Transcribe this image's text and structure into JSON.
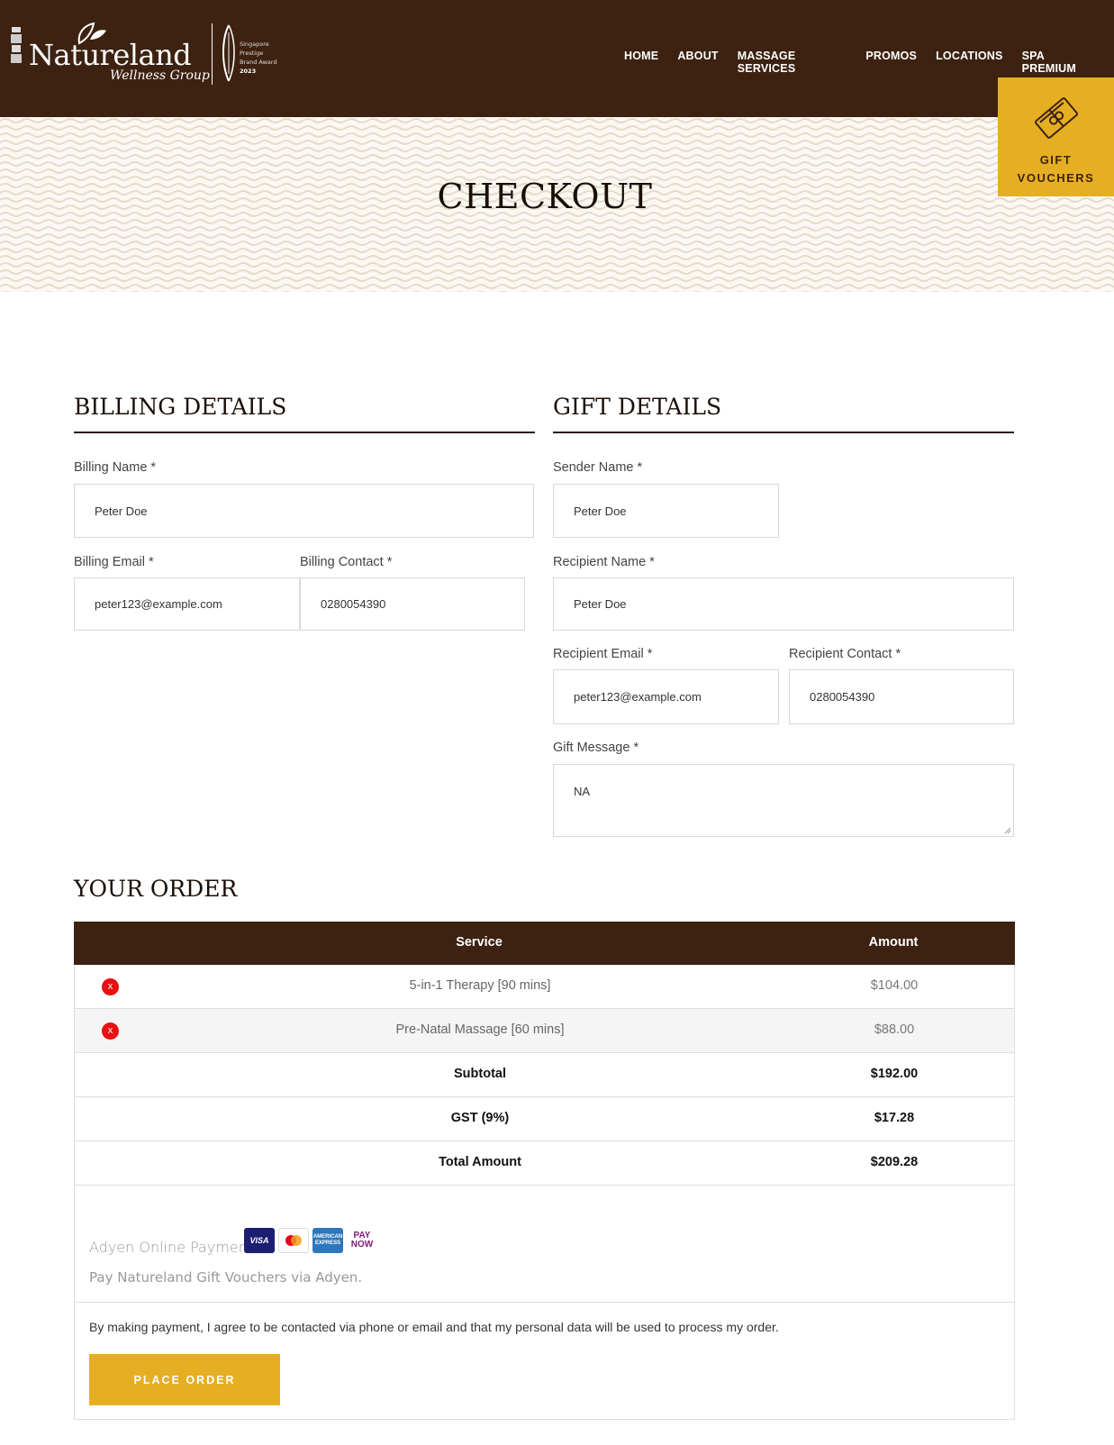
{
  "brand": {
    "name": "Natureland",
    "subtitle": "Wellness Group",
    "award_lines": [
      "Singapore",
      "Prestige",
      "Brand Award",
      "2023"
    ]
  },
  "nav": {
    "items": [
      "HOME",
      "ABOUT",
      "MASSAGE SERVICES",
      "PROMOS",
      "LOCATIONS",
      "SPA PREMIUM"
    ]
  },
  "gift_badge": {
    "line1": "GIFT",
    "line2": "VOUCHERS",
    "icon": "gift-voucher-icon"
  },
  "page_title": "CHECKOUT",
  "billing": {
    "title": "BILLING DETAILS",
    "name_label": "Billing Name *",
    "name_value": "Peter Doe",
    "email_label": "Billing Email *",
    "email_value": "peter123@example.com",
    "contact_label": "Billing Contact *",
    "contact_value": "0280054390"
  },
  "gift": {
    "title": "GIFT DETAILS",
    "sender_label": "Sender Name *",
    "sender_value": "Peter Doe",
    "recipient_label": "Recipient Name *",
    "recipient_value": "Peter Doe",
    "recipient_email_label": "Recipient Email *",
    "recipient_email_value": "peter123@example.com",
    "recipient_contact_label": "Recipient Contact *",
    "recipient_contact_value": "0280054390",
    "message_label": "Gift Message *",
    "message_value": "NA"
  },
  "order": {
    "title": "YOUR ORDER",
    "col_service": "Service",
    "col_amount": "Amount",
    "items": [
      {
        "service": "5-in-1 Therapy [90 mins]",
        "amount": "$104.00",
        "remove": "x"
      },
      {
        "service": "Pre-Natal Massage [60 mins]",
        "amount": "$88.00",
        "remove": "x"
      }
    ],
    "subtotal_label": "Subtotal",
    "subtotal_value": "$192.00",
    "gst_label": "GST (9%)",
    "gst_value": "$17.28",
    "total_label": "Total Amount",
    "total_value": "$209.28"
  },
  "payment": {
    "method": "Adyen Online Payment",
    "description": "Pay Natureland Gift Vouchers via Adyen.",
    "cards": [
      "VISA",
      "AMERICAN EXPRESS",
      "PAY NOW"
    ]
  },
  "consent_text": "By making payment, I agree to be contacted via phone or email and that my personal data will be used to process my order.",
  "place_order_label": "PLACE ORDER",
  "colors": {
    "brown": "#3d2211",
    "gold": "#e6ae22",
    "remove_red": "#e81010"
  }
}
